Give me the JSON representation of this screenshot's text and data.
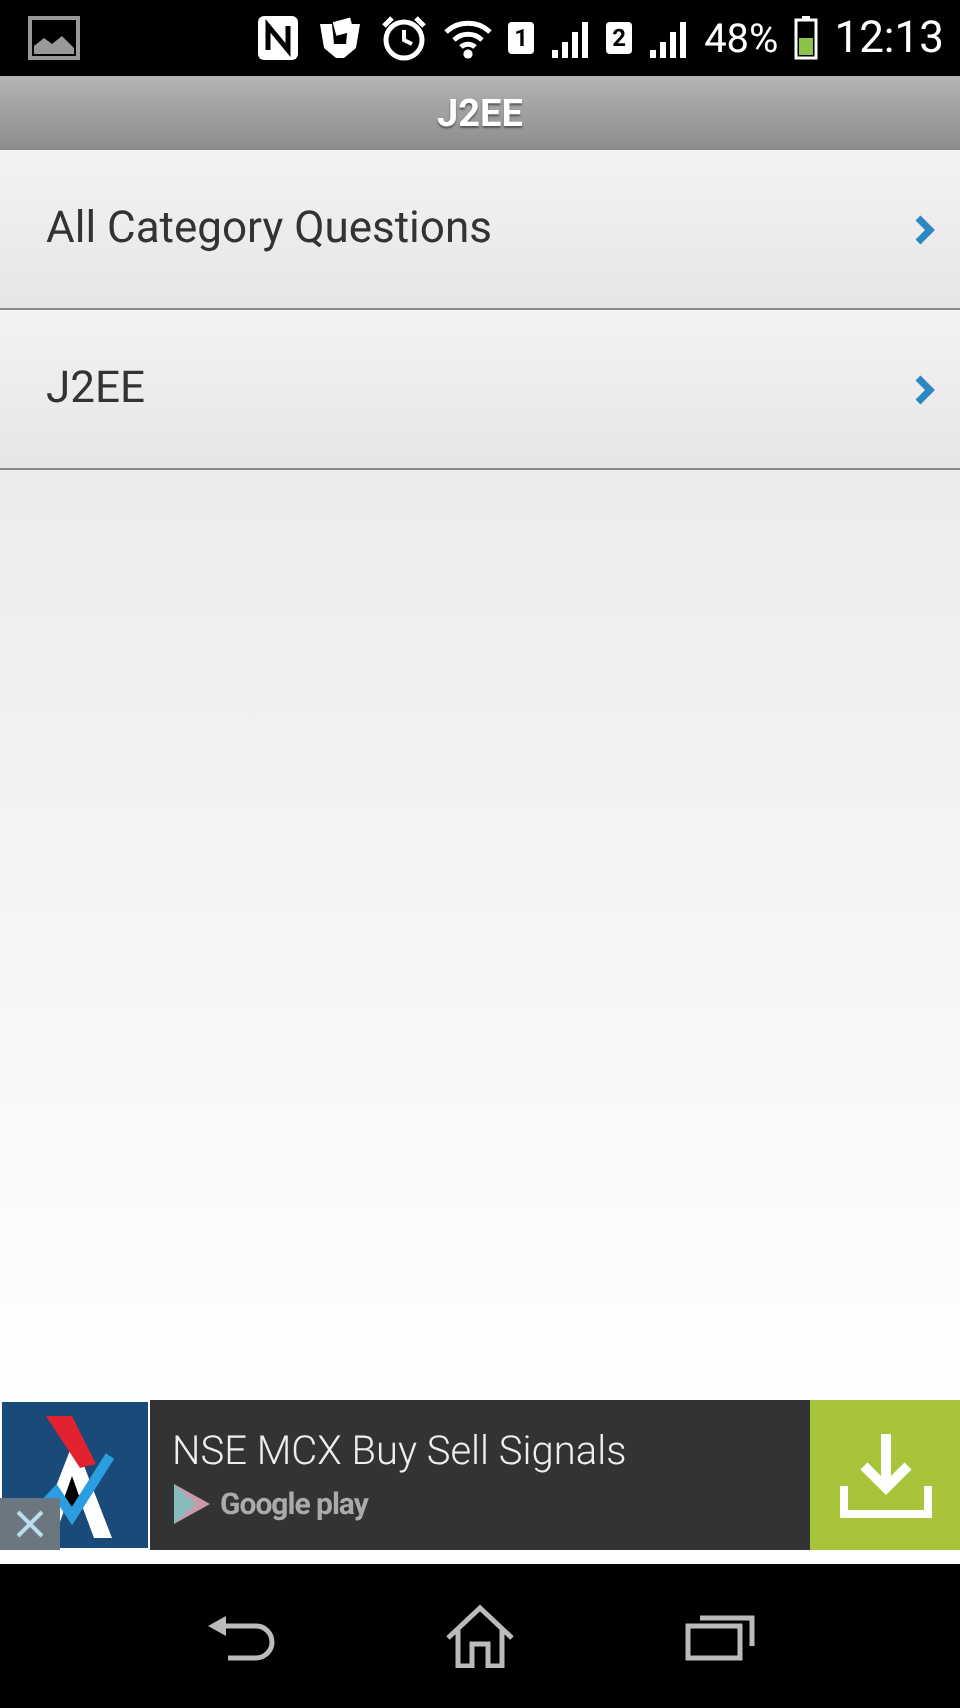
{
  "status_bar": {
    "sim_1": "1",
    "sim_2": "2",
    "battery": "48%",
    "time": "12:13"
  },
  "title": "J2EE",
  "items": [
    {
      "label": "All Category Questions"
    },
    {
      "label": "J2EE"
    }
  ],
  "ad": {
    "headline": "NSE MCX Buy Sell Signals",
    "store": "Google play"
  }
}
